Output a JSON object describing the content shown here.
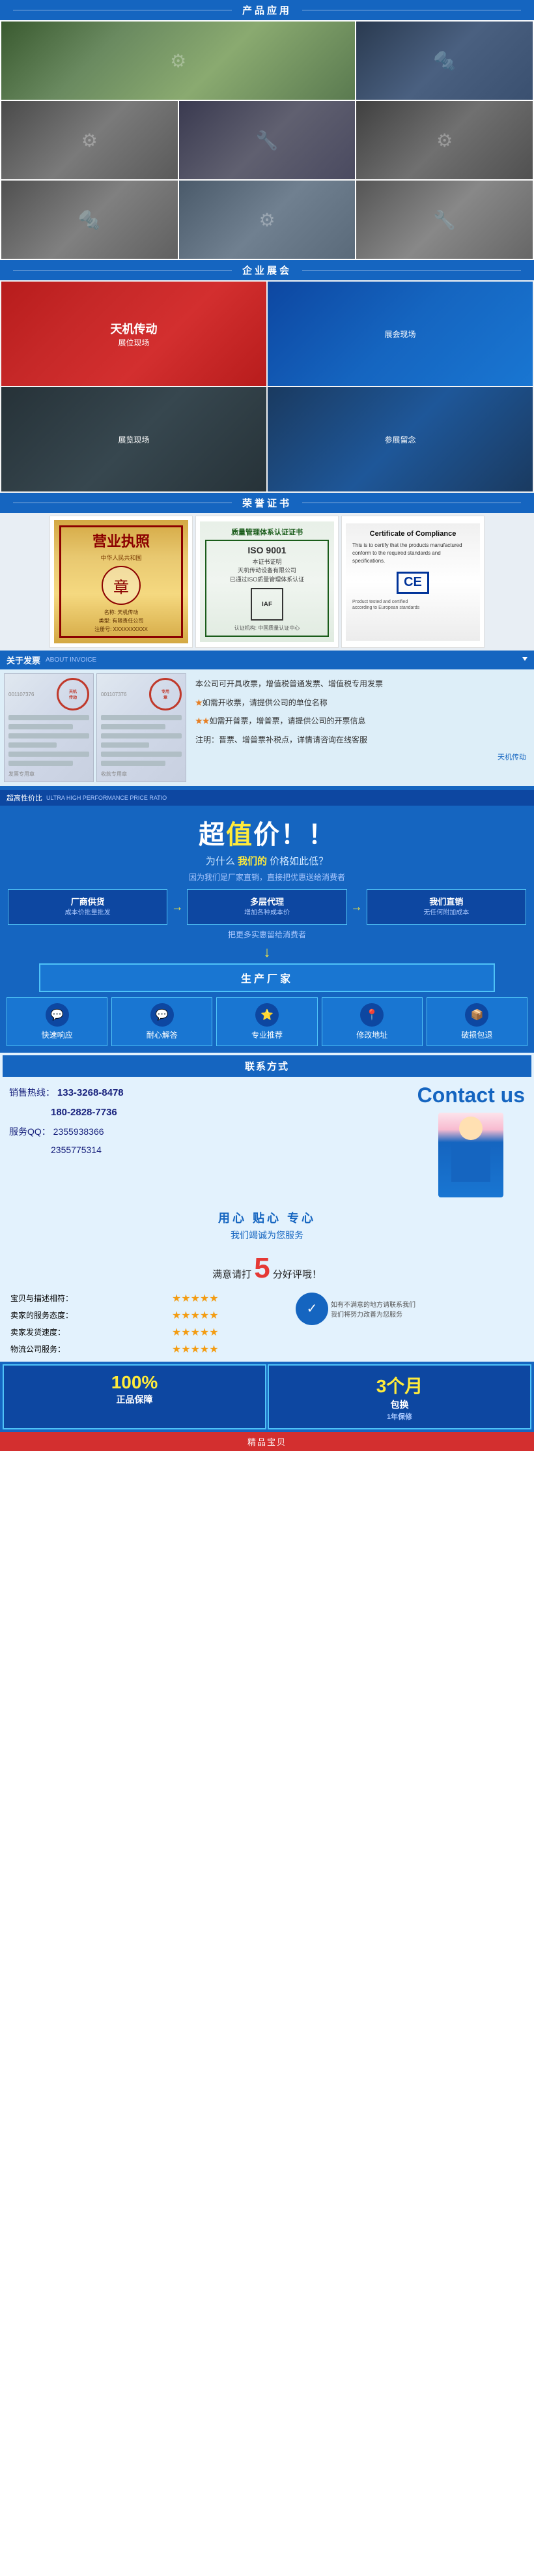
{
  "sections": {
    "product_apps": {
      "title": "产品应用",
      "images": [
        {
          "id": 1,
          "class": "img-machine-1",
          "alt": "machine 1",
          "span": "wide"
        },
        {
          "id": 2,
          "class": "img-machine-2",
          "alt": "machine 2",
          "span": "normal"
        },
        {
          "id": 3,
          "class": "img-machine-3",
          "alt": "machine 3",
          "span": "normal"
        },
        {
          "id": 4,
          "class": "img-machine-4",
          "alt": "machine 4",
          "span": "normal"
        },
        {
          "id": 5,
          "class": "img-machine-5",
          "alt": "machine 5",
          "span": "normal"
        },
        {
          "id": 6,
          "class": "img-machine-6",
          "alt": "machine 6",
          "span": "normal"
        },
        {
          "id": 7,
          "class": "img-machine-7",
          "alt": "machine 7",
          "span": "normal"
        }
      ]
    },
    "enterprise": {
      "title": "企业展会"
    },
    "honor": {
      "title": "荣誉证书",
      "certs": [
        {
          "id": "yinzhao",
          "type": "营业执照",
          "big_char": "营业执照",
          "lines": [
            "注册号: XXXXXXXXXX",
            "名称: 天机传动",
            "类型: 有限责任公司"
          ]
        },
        {
          "id": "iso",
          "type": "ISO认证",
          "title": "质量管理体系认证证书",
          "subtitle": "ISO 9001",
          "text": "本证书证明\n天机传动设备\n已通过ISO质量认证"
        },
        {
          "id": "compliance",
          "type": "Certificate of Compliance",
          "title": "Certificate of Compliance",
          "ce_label": "CE",
          "body": "This is to certify that the products manufactured conform to the required standards and specifications."
        }
      ]
    },
    "invoice": {
      "label": "关于发票",
      "label_en": "ABOUT INVOICE",
      "points": [
        "本公司可开具收票，增值税普通发票、增值税专用发票",
        "★如需开收票，请提供公司的单位名称",
        "★★如需开普票，增普票，请提供公司的开票信息",
        "注明：晋票、增普票补税点，详情请咨询在线客服"
      ],
      "footer_text": "天机传动"
    },
    "price": {
      "header_zh": "超高性价比",
      "header_en": "ULTRA HIGH PERFORMANCE PRICE RATIO",
      "main_title": "超值价！！",
      "sub_question": "为什么 我们的 价格如此低？",
      "sub_question_em": "我们的",
      "reason": "因为我们是厂家直销，直接把优惠送给消费者",
      "boxes": [
        {
          "label": "厂商供货",
          "sub": "成本价批量批发"
        },
        {
          "label": "多层代理",
          "sub": "增加各种成本价"
        },
        {
          "label": "我们直销",
          "sub": "无任何附加成本"
        }
      ],
      "factory_label": "生产厂家",
      "feature_label": "把更多实惠留给消费者",
      "features": [
        {
          "icon": "⚡",
          "label": "快速响应"
        },
        {
          "icon": "💬",
          "label": "耐心解答"
        },
        {
          "icon": "⭐",
          "label": "专业推荐"
        },
        {
          "icon": "🔧",
          "label": "修改地址"
        },
        {
          "icon": "📦",
          "label": "破损包退"
        }
      ]
    },
    "contact": {
      "title": "联系方式",
      "phone_label": "销售热线：",
      "phone1": "133-3268-8478",
      "phone2": "180-2828-7736",
      "qq_label": "服务QQ：",
      "qq1": "2355938366",
      "qq2": "2355775314",
      "contact_us": "Contact us",
      "slogan": "用心 贴心 专心",
      "slogan_sub": "我们竭诚为您服务",
      "rating_ask": "满意请打",
      "rating_num": "5",
      "rating_ask2": "分好评哦！",
      "ratings": [
        {
          "label": "宝贝与描述相符：",
          "stars": "★★★★★"
        },
        {
          "label": "卖家的服务态度：",
          "stars": "★★★★★"
        },
        {
          "label": "卖家发货速度：",
          "stars": "★★★★★"
        },
        {
          "label": "物流公司服务：",
          "stars": "★★★★★"
        }
      ],
      "complaint_text": "如有不满意的地方请联系我们\n我们将努力改善为您服务",
      "guarantee1_big": "100%",
      "guarantee1_label": "正品保障",
      "guarantee2_big": "3个月",
      "guarantee2_label": "包换",
      "guarantee2_sub": "1年保修"
    },
    "footer": {
      "label": "精品宝贝"
    }
  }
}
